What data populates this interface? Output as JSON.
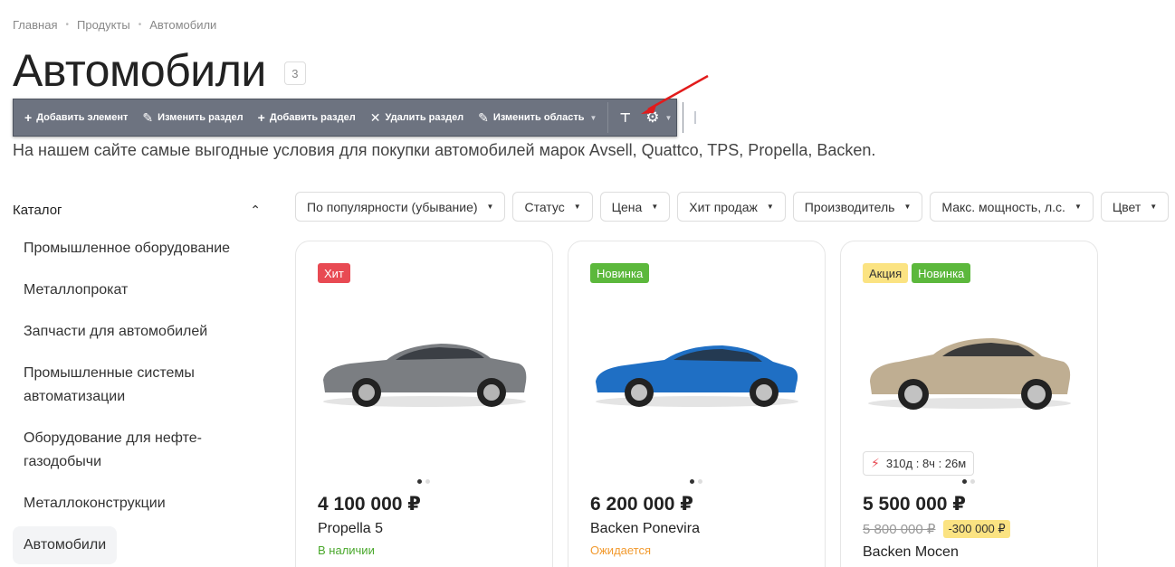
{
  "breadcrumb": {
    "items": [
      "Главная",
      "Продукты",
      "Автомобили"
    ]
  },
  "page": {
    "title": "Автомобили",
    "count": "3",
    "intro": "На нашем сайте самые выгодные условия для покупки автомобилей марок Avsell, Quattco, TPS, Propella, Backen."
  },
  "admin_toolbar": {
    "add_element": "Добавить элемент",
    "edit_section": "Изменить раздел",
    "add_section": "Добавить раздел",
    "delete_section": "Удалить раздел",
    "edit_area": "Изменить область"
  },
  "sidebar": {
    "heading": "Каталог",
    "items": [
      "Промышленное оборудование",
      "Металлопрокат",
      "Запчасти для автомобилей",
      "Промышленные системы автоматизации",
      "Оборудование для нефте-газодобычи",
      "Металлоконструкции",
      "Автомобили"
    ]
  },
  "filters": [
    "По популярности (убывание)",
    "Статус",
    "Цена",
    "Хит продаж",
    "Производитель",
    "Макс. мощность, л.с.",
    "Цвет"
  ],
  "products": [
    {
      "badges": [
        "Хит"
      ],
      "price": "4 100 000 ₽",
      "name": "Propella 5",
      "availability": "В наличии",
      "car_color": "#7b7e82"
    },
    {
      "badges": [
        "Новинка"
      ],
      "price": "6 200 000 ₽",
      "name": "Backen Ponevira",
      "availability": "Ожидается",
      "car_color": "#1f6fc4"
    },
    {
      "badges": [
        "Акция",
        "Новинка"
      ],
      "timer": "310д : 8ч : 26м",
      "price": "5 500 000 ₽",
      "old_price": "5 800 000 ₽",
      "discount": "-300 000 ₽",
      "name": "Backen Mocen",
      "car_color": "#bfae92"
    }
  ],
  "colors": {
    "badge_hit": "#e84a53",
    "badge_new": "#5cb83c",
    "badge_sale": "#fbe382",
    "toolbar_bg": "#6d7380",
    "in_stock": "#4aa82c",
    "awaiting": "#f29a2e"
  }
}
